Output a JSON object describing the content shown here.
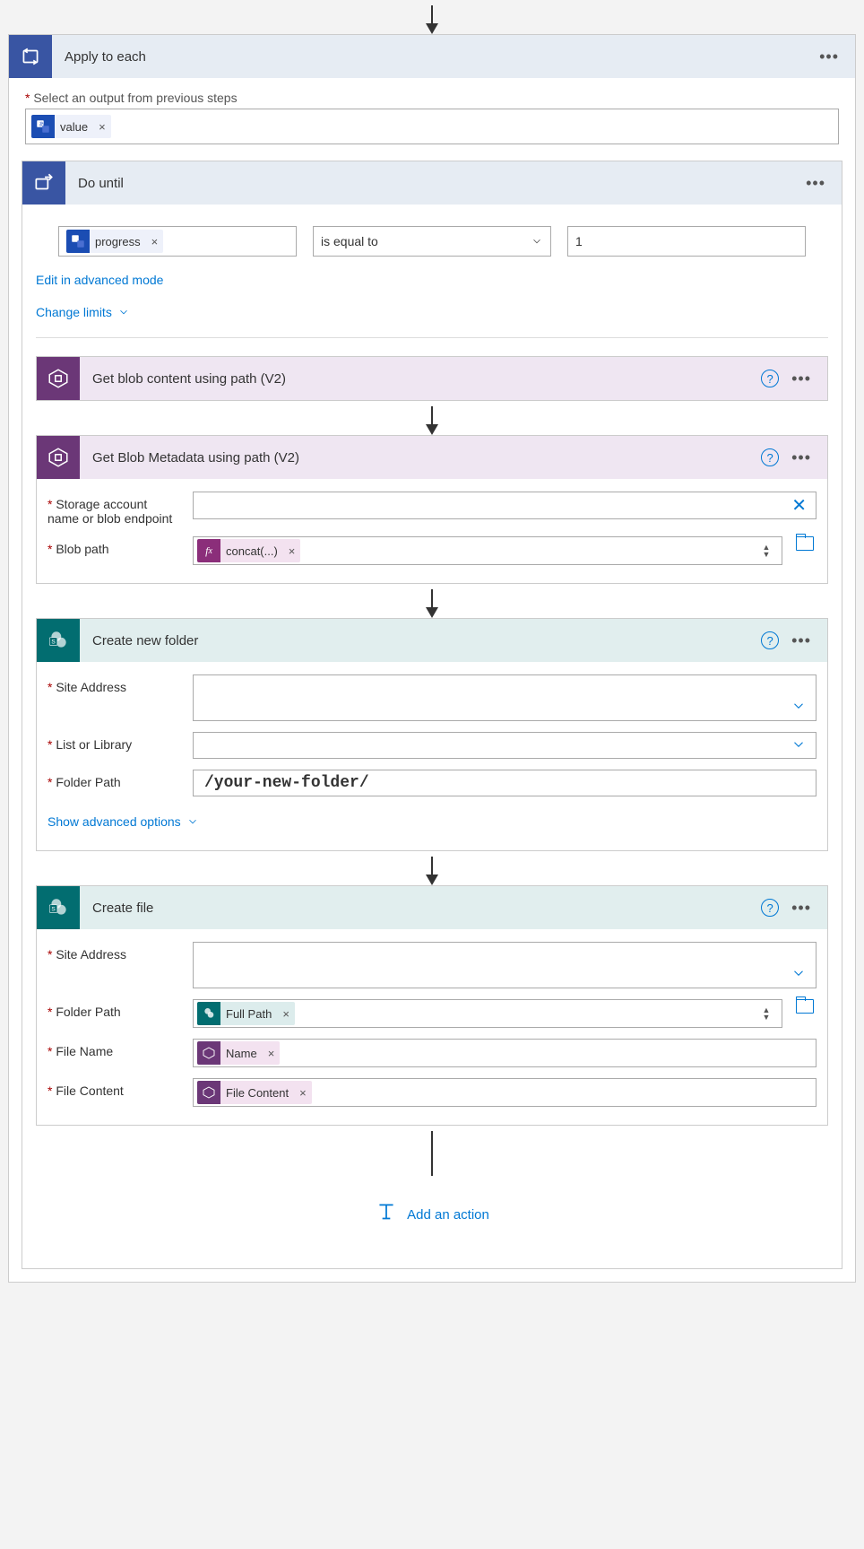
{
  "applyToEach": {
    "title": "Apply to each",
    "selectLabel": "Select an output from previous steps",
    "valueToken": "value"
  },
  "doUntil": {
    "title": "Do until",
    "progressToken": "progress",
    "operator": "is equal to",
    "value": "1",
    "editAdvanced": "Edit in advanced mode",
    "changeLimits": "Change limits"
  },
  "getBlobContent": {
    "title": "Get blob content using path (V2)"
  },
  "getBlobMetadata": {
    "title": "Get Blob Metadata using path (V2)",
    "storageLabel": "Storage account name or blob endpoint",
    "blobPathLabel": "Blob path",
    "concatToken": "concat(...)"
  },
  "createFolder": {
    "title": "Create new folder",
    "siteAddressLabel": "Site Address",
    "listLibraryLabel": "List or Library",
    "folderPathLabel": "Folder Path",
    "folderPathValue": "/your-new-folder/",
    "showAdvanced": "Show advanced options"
  },
  "createFile": {
    "title": "Create file",
    "siteAddressLabel": "Site Address",
    "folderPathLabel": "Folder Path",
    "fullPathToken": "Full Path",
    "fileNameLabel": "File Name",
    "nameToken": "Name",
    "fileContentLabel": "File Content",
    "fileContentToken": "File Content"
  },
  "addAction": "Add an action"
}
